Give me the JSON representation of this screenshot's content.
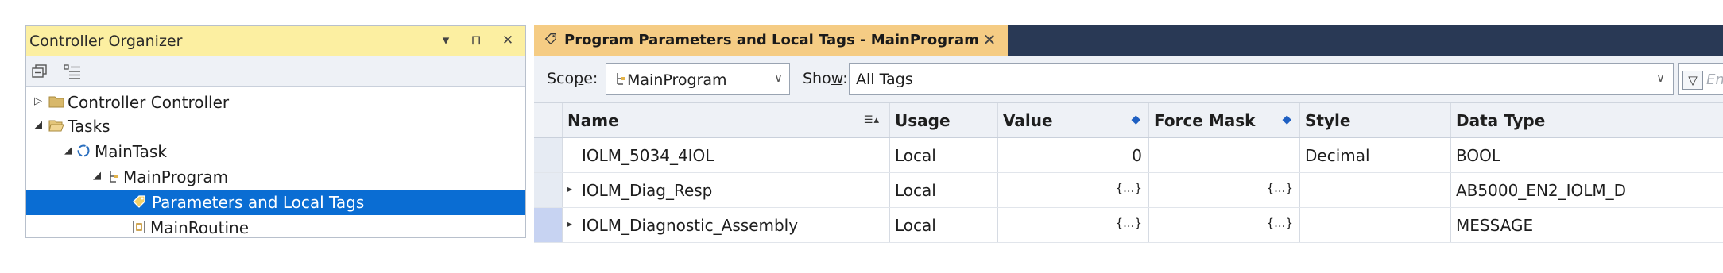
{
  "organizer": {
    "title": "Controller Organizer",
    "title_controls": {
      "menu": "▾",
      "pin": "⊓",
      "close": "✕"
    },
    "toolbar_icons": [
      "collapse-all-icon",
      "expand-all-icon"
    ],
    "tree": [
      {
        "label": "Controller Controller",
        "expander": "▷",
        "icon": "folder-icon"
      },
      {
        "label": "Tasks",
        "expander": "◢",
        "icon": "open-folder-icon"
      },
      {
        "label": "MainTask",
        "expander": "◢",
        "icon": "task-cycle-icon"
      },
      {
        "label": "MainProgram",
        "expander": "◢",
        "icon": "program-icon"
      },
      {
        "label": "Parameters and Local Tags",
        "expander": "",
        "icon": "tag-icon",
        "selected": true
      },
      {
        "label": "MainRoutine",
        "expander": "",
        "icon": "ladder-routine-icon"
      }
    ]
  },
  "document": {
    "tab_label": "Program Parameters and Local Tags - MainProgram",
    "tab_close": "✕",
    "scope_label_pre": "Sco",
    "scope_label_u": "p",
    "scope_label_post": "e:",
    "scope_value": "MainProgram",
    "show_label_pre": "Sho",
    "show_label_u": "w",
    "show_label_post": ":",
    "show_value": "All Tags",
    "name_filter_placeholder": "Enter Name Filter...",
    "columns": {
      "name": "Name",
      "usage": "Usage",
      "value": "Value",
      "force_mask": "Force Mask",
      "style": "Style",
      "data_type": "Data Type"
    },
    "rows": [
      {
        "expander": "",
        "name": "IOLM_5034_4IOL",
        "usage": "Local",
        "value": "0",
        "force_mask": "",
        "style": "Decimal",
        "data_type": "BOOL"
      },
      {
        "expander": "▸",
        "name": "IOLM_Diag_Resp",
        "usage": "Local",
        "value": "{...}",
        "force_mask": "{...}",
        "style": "",
        "data_type": "AB5000_EN2_IOLM_D"
      },
      {
        "expander": "▸",
        "name": "IOLM_Diagnostic_Assembly",
        "usage": "Local",
        "value": "{...}",
        "force_mask": "{...}",
        "style": "",
        "data_type": "MESSAGE"
      }
    ]
  },
  "colors": {
    "organizer_title_bg": "#fcefa1",
    "selected_row_bg": "#0a6dd3",
    "tab_active_bg": "#f5cc84",
    "tabstrip_bg": "#293955"
  }
}
